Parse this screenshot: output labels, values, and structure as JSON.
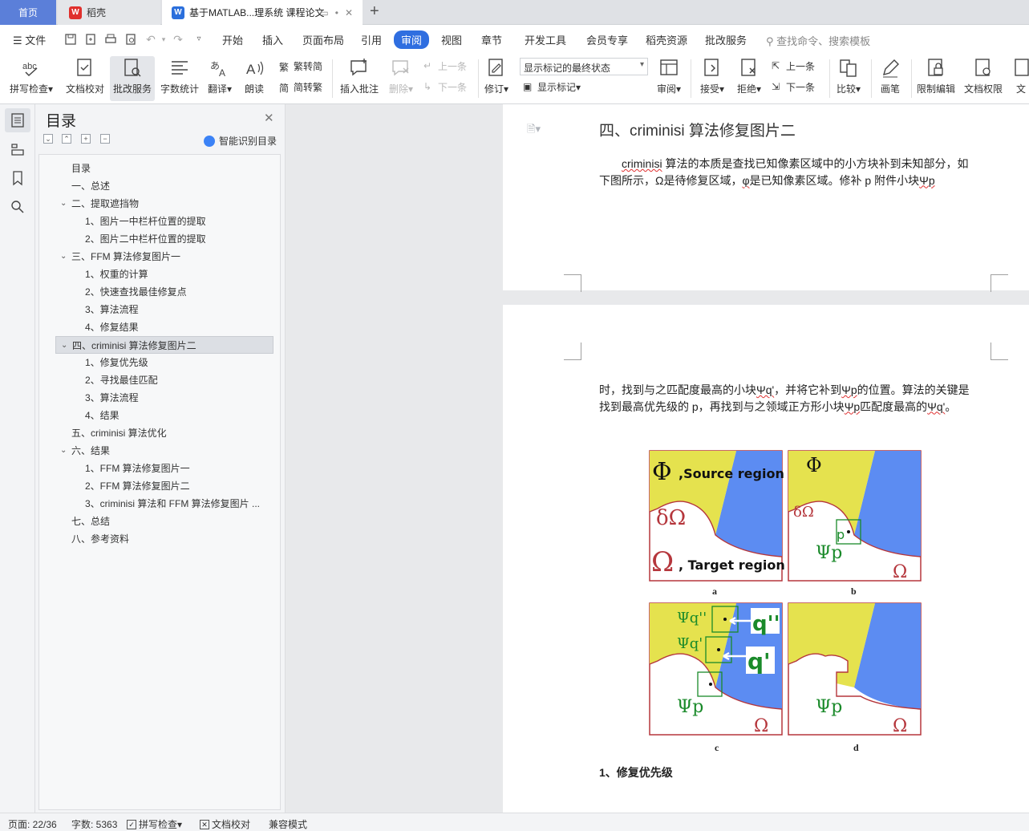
{
  "tabs": {
    "home": "首页",
    "daoke": "稻壳",
    "doc": "基于MATLAB...理系统 课程论文"
  },
  "menu": {
    "file": "文件",
    "items": [
      "开始",
      "插入",
      "页面布局",
      "引用",
      "审阅",
      "视图",
      "章节",
      "开发工具",
      "会员专享",
      "稻壳资源",
      "批改服务"
    ],
    "active_index": 4,
    "search_placeholder": "查找命令、搜索模板"
  },
  "ribbon": {
    "spellcheck": "拼写检查",
    "doc_check": "文档校对",
    "revise_service": "批改服务",
    "word_count": "字数统计",
    "translate": "翻译",
    "read_aloud": "朗读",
    "trad_to_simp": "繁转简",
    "simp_to_trad": "简转繁",
    "insert_comment": "插入批注",
    "delete": "删除",
    "prev_comment": "上一条",
    "next_comment": "下一条",
    "track_changes": "修订",
    "markup_state": "显示标记的最终状态",
    "show_markup": "显示标记",
    "review": "审阅",
    "accept": "接受",
    "reject": "拒绝",
    "prev_change": "上一条",
    "next_change": "下一条",
    "compare": "比较",
    "pen": "画笔",
    "restrict_edit": "限制编辑",
    "doc_permission": "文档权限",
    "doc_more": "文"
  },
  "outline": {
    "title": "目录",
    "smart_toc": "智能识别目录",
    "items": [
      {
        "label": "目录",
        "level": 1,
        "chevron": false
      },
      {
        "label": "一、总述",
        "level": 1,
        "chevron": false
      },
      {
        "label": "二、提取遮挡物",
        "level": 1,
        "chevron": true
      },
      {
        "label": "1、图片一中栏杆位置的提取",
        "level": 2,
        "chevron": false
      },
      {
        "label": "2、图片二中栏杆位置的提取",
        "level": 2,
        "chevron": false
      },
      {
        "label": "三、FFM 算法修复图片一",
        "level": 1,
        "chevron": true
      },
      {
        "label": "1、权重的计算",
        "level": 2,
        "chevron": false
      },
      {
        "label": "2、快速查找最佳修复点",
        "level": 2,
        "chevron": false
      },
      {
        "label": "3、算法流程",
        "level": 2,
        "chevron": false
      },
      {
        "label": "4、修复结果",
        "level": 2,
        "chevron": false
      },
      {
        "label": "四、criminisi 算法修复图片二",
        "level": 1,
        "chevron": true,
        "selected": true
      },
      {
        "label": "1、修复优先级",
        "level": 2,
        "chevron": false
      },
      {
        "label": "2、寻找最佳匹配",
        "level": 2,
        "chevron": false
      },
      {
        "label": "3、算法流程",
        "level": 2,
        "chevron": false
      },
      {
        "label": "4、结果",
        "level": 2,
        "chevron": false
      },
      {
        "label": "五、criminisi 算法优化",
        "level": 1,
        "chevron": false
      },
      {
        "label": "六、结果",
        "level": 1,
        "chevron": true
      },
      {
        "label": "1、FFM 算法修复图片一",
        "level": 2,
        "chevron": false
      },
      {
        "label": "2、FFM 算法修复图片二",
        "level": 2,
        "chevron": false
      },
      {
        "label": "3、criminisi 算法和 FFM 算法修复图片 ...",
        "level": 2,
        "chevron": false
      },
      {
        "label": "七、总结",
        "level": 1,
        "chevron": false
      },
      {
        "label": "八、参考资料",
        "level": 1,
        "chevron": false
      }
    ]
  },
  "document": {
    "heading": "四、criminisi 算法修复图片二",
    "para1_a": "criminisi",
    "para1_b": " 算法的本质是查找已知像素区域中的小方块补到未知部分，如下图所示，Ω是待修复区域，",
    "para1_c": "φ",
    "para1_d": "是已知像素区域。修补 p 附件小块",
    "para1_e": "Ψp",
    "para2_a": "时，找到与之匹配度最高的小块",
    "para2_b": "Ψq'",
    "para2_c": "，并将它补到",
    "para2_d": "Ψp",
    "para2_e": "的位置。算法的关键是找到最高优先级的 p，再找到与之领域正方形小块",
    "para2_f": "Ψp",
    "para2_g": "匹配度最高的",
    "para2_h": "Ψq'",
    "para2_i": "。",
    "figure": {
      "phi": "Φ",
      "source_region": ",Source region",
      "target_region": ", Target region",
      "omega": "Ω",
      "delta_omega": "δΩ",
      "p": "p",
      "psi_p": "Ψp",
      "psi_q2": "Ψq''",
      "psi_q1": "Ψq'",
      "q2": "q''",
      "q1": "q'",
      "labels": [
        "a",
        "b",
        "c",
        "d"
      ]
    },
    "subheading": "1、修复优先级"
  },
  "status": {
    "page": "页面: 22/36",
    "words": "字数: 5363",
    "spellcheck": "拼写检查",
    "doc_check": "文档校对",
    "compat": "兼容模式"
  },
  "colors": {
    "accent": "#2f6ee0",
    "source_yellow": "#e5e24e",
    "target_blue": "#5c8cf2",
    "fig_green": "#1a8a2a",
    "error_red": "#e03030"
  }
}
